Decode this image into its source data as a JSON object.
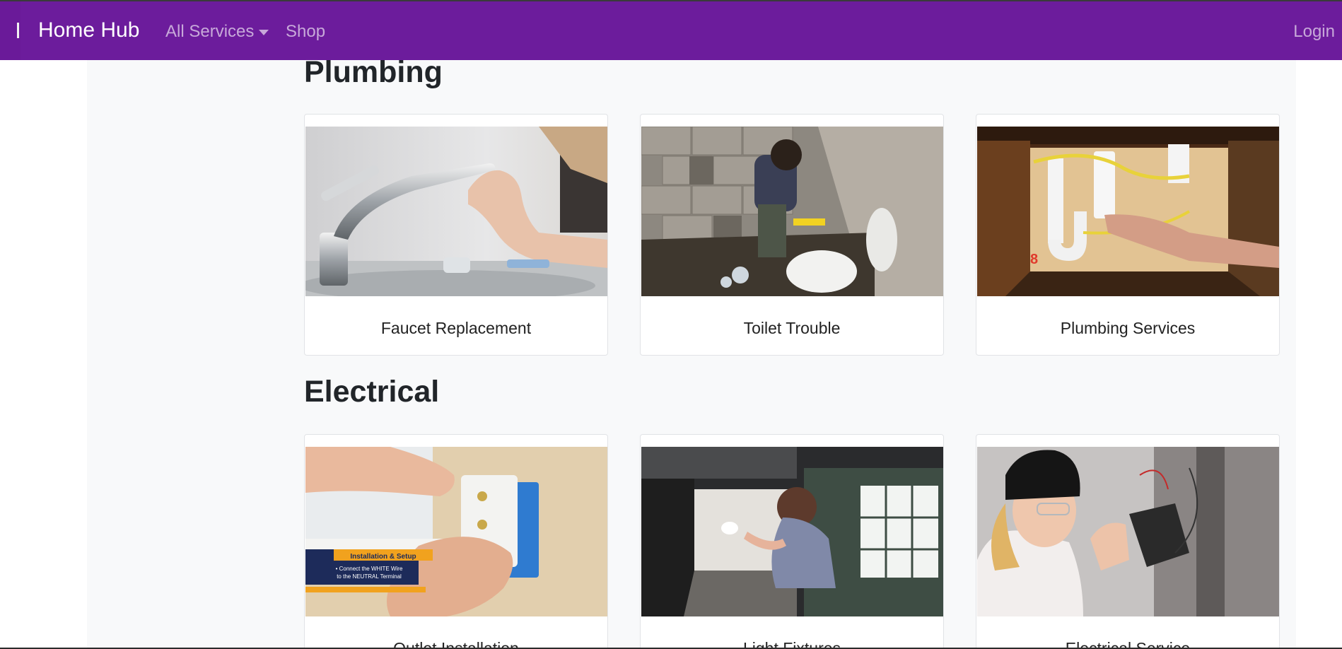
{
  "navbar": {
    "brand": "Home Hub",
    "links": [
      {
        "label": "All Services",
        "has_dropdown": true
      },
      {
        "label": "Shop"
      }
    ],
    "login_label": "Login",
    "background_color": "#6c1c9c"
  },
  "sections": [
    {
      "title": "Plumbing",
      "cards": [
        {
          "label": "Faucet Replacement"
        },
        {
          "label": "Toilet Trouble"
        },
        {
          "label": "Plumbing Services"
        }
      ]
    },
    {
      "title": "Electrical",
      "cards": [
        {
          "label": "Outlet Installation"
        },
        {
          "label": "Light Fixtures"
        },
        {
          "label": "Electrical Service"
        }
      ]
    }
  ],
  "image_overlays": {
    "outlet_caption_title": "Installation & Setup",
    "outlet_caption_line1": "• Connect the WHITE Wire",
    "outlet_caption_line2": "to the NEUTRAL Terminal",
    "plumbing_tag": "8"
  }
}
